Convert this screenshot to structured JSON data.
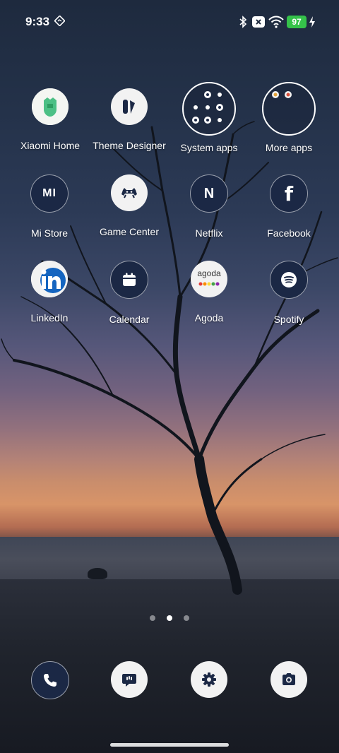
{
  "status": {
    "time": "9:33",
    "battery": "97"
  },
  "apps": [
    {
      "label": "Xiaomi Home"
    },
    {
      "label": "Theme Designer"
    },
    {
      "label": "System apps"
    },
    {
      "label": "More apps"
    },
    {
      "label": "Mi Store"
    },
    {
      "label": "Game Center"
    },
    {
      "label": "Netflix"
    },
    {
      "label": "Facebook"
    },
    {
      "label": "LinkedIn"
    },
    {
      "label": "Calendar"
    },
    {
      "label": "Agoda"
    },
    {
      "label": "Spotify"
    }
  ],
  "icon_text": {
    "mi": "MI",
    "netflix": "N",
    "facebook": "f",
    "agoda": "agoda"
  },
  "pages": {
    "count": 3,
    "active": 2
  },
  "dock": [
    {
      "icon": "phone-icon"
    },
    {
      "icon": "messages-icon"
    },
    {
      "icon": "settings-icon"
    },
    {
      "icon": "camera-icon"
    }
  ],
  "colors": {
    "battery": "#35c24a",
    "icon_bg": "#1b2845"
  }
}
